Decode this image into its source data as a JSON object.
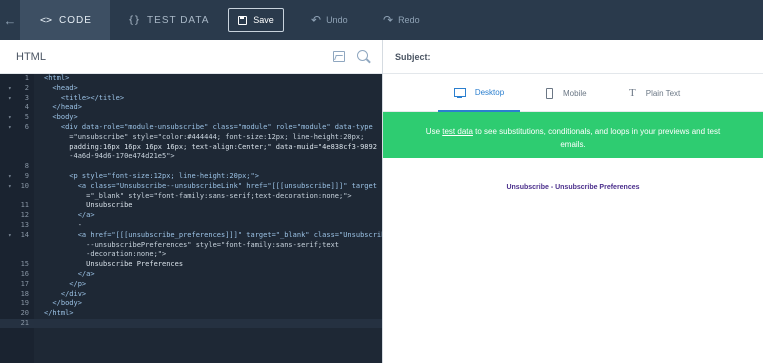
{
  "topbar": {
    "back_icon": "arrow-left",
    "tabs": [
      {
        "glyph": "<>",
        "label": "CODE",
        "active": true
      },
      {
        "glyph": "{}",
        "label": "TEST DATA",
        "active": false
      }
    ],
    "save_label": "Save",
    "undo_label": "Undo",
    "redo_label": "Redo"
  },
  "editor": {
    "title": "HTML",
    "icons": [
      "image-icon",
      "search-icon"
    ],
    "lines": [
      {
        "n": "1",
        "fold": "",
        "text": "<html>"
      },
      {
        "n": "2",
        "fold": "▾",
        "text": "  <head>"
      },
      {
        "n": "3",
        "fold": "▾",
        "text": "    <title></title>"
      },
      {
        "n": "4",
        "fold": "",
        "text": "  </head>"
      },
      {
        "n": "5",
        "fold": "▾",
        "text": "  <body>"
      },
      {
        "n": "6",
        "fold": "▾",
        "text": "    <div data-role=\"module-unsubscribe\" class=\"module\" role=\"module\" data-type"
      },
      {
        "n": "",
        "fold": "",
        "text": "      =\"unsubscribe\" style=\"color:#444444; font-size:12px; line-height:20px;"
      },
      {
        "n": "",
        "fold": "",
        "text": "      padding:16px 16px 16px 16px; text-align:Center;\" data-muid=\"4e838cf3-9892"
      },
      {
        "n": "",
        "fold": "",
        "text": "      -4a6d-94d6-170e474d21e5\">"
      },
      {
        "n": "8",
        "fold": "",
        "text": ""
      },
      {
        "n": "9",
        "fold": "▾",
        "text": "      <p style=\"font-size:12px; line-height:20px;\">"
      },
      {
        "n": "10",
        "fold": "▾",
        "text": "        <a class=\"Unsubscribe--unsubscribeLink\" href=\"[[[unsubscribe]]]\" target"
      },
      {
        "n": "",
        "fold": "",
        "text": "          =\"_blank\" style=\"font-family:sans-serif;text-decoration:none;\">"
      },
      {
        "n": "11",
        "fold": "",
        "text": "          Unsubscribe"
      },
      {
        "n": "12",
        "fold": "",
        "text": "        </a>"
      },
      {
        "n": "13",
        "fold": "",
        "text": "        -"
      },
      {
        "n": "14",
        "fold": "▾",
        "text": "        <a href=\"[[[unsubscribe_preferences]]]\" target=\"_blank\" class=\"Unsubscribe"
      },
      {
        "n": "",
        "fold": "",
        "text": "          --unsubscribePreferences\" style=\"font-family:sans-serif;text"
      },
      {
        "n": "",
        "fold": "",
        "text": "          -decoration:none;\">"
      },
      {
        "n": "15",
        "fold": "",
        "text": "          Unsubscribe Preferences"
      },
      {
        "n": "16",
        "fold": "",
        "text": "        </a>"
      },
      {
        "n": "17",
        "fold": "",
        "text": "      </p>"
      },
      {
        "n": "18",
        "fold": "",
        "text": "    </div>"
      },
      {
        "n": "19",
        "fold": "",
        "text": "  </body>"
      },
      {
        "n": "20",
        "fold": "",
        "text": "</html>"
      },
      {
        "n": "21",
        "fold": "",
        "text": ""
      }
    ],
    "active_line": "21"
  },
  "right": {
    "subject_label": "Subject:",
    "device_tabs": [
      {
        "label": "Desktop",
        "icon": "monitor-icon",
        "active": true
      },
      {
        "label": "Mobile",
        "icon": "phone-icon",
        "active": false
      },
      {
        "label": "Plain Text",
        "icon": "text-icon",
        "active": false
      }
    ],
    "banner": {
      "before": "Use ",
      "link": "test data",
      "after": " to see substitutions, conditionals, and loops in your previews and test emails."
    },
    "preview_links": "Unsubscribe - Unsubscribe Preferences"
  },
  "colors": {
    "topbar_bg": "#2a3a4c",
    "editor_bg": "#1e2835",
    "banner_bg": "#2ecc71",
    "accent": "#2b7fcf",
    "link_purple": "#4b2f8c"
  }
}
